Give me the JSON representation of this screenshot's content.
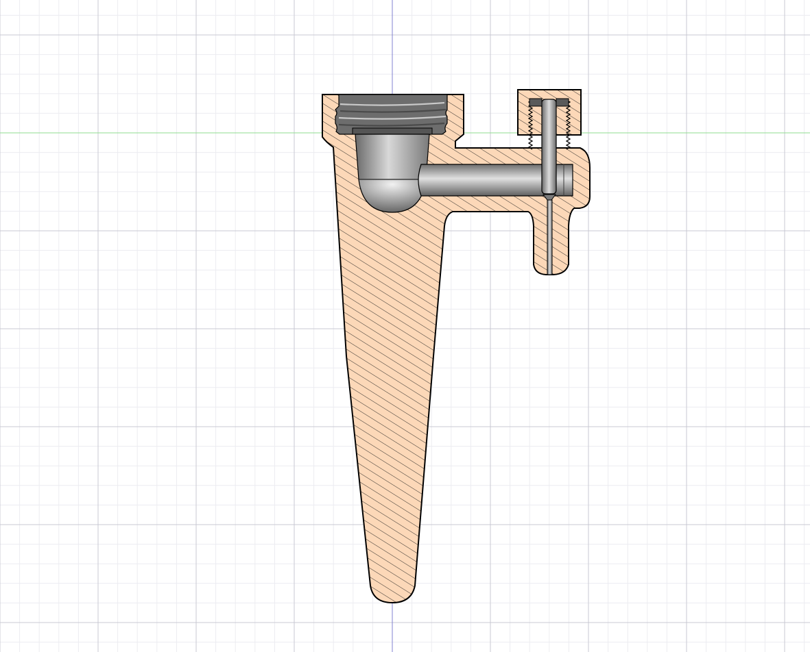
{
  "view": {
    "type": "cad-section-view",
    "background_color": "#ffffff",
    "grid": {
      "minor_color": "#ececf1",
      "major_color": "#c9c9d3"
    },
    "axes": {
      "vertical_axis_color": "#8080d0",
      "horizontal_axis_color": "#8fdc8f"
    }
  },
  "model": {
    "section_fill_color": "#fcd8b8",
    "hatch_color": "#1a1a1a",
    "outline_color": "#000000",
    "cavity_colors": {
      "dark": "#5b5b5b",
      "mid": "#9a9a9a",
      "light": "#d6d6d6"
    },
    "features": [
      "main-body-section",
      "threaded-socket",
      "bowl-cavity",
      "horizontal-channel",
      "screw-cap-section",
      "threaded-screw",
      "vertical-drain-hole"
    ]
  }
}
